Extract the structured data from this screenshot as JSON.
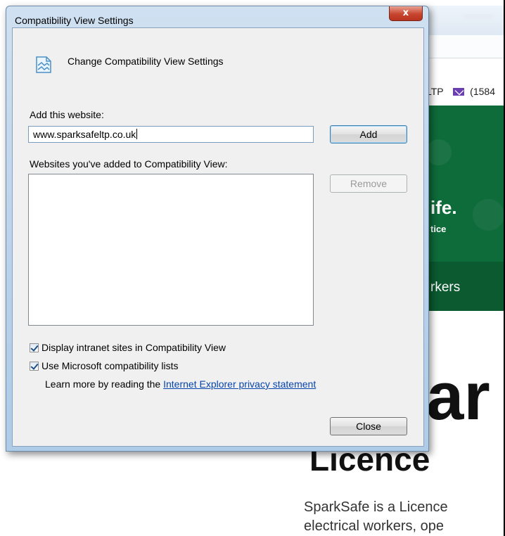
{
  "background_page": {
    "contact_text": "LTP",
    "phone_text": "(1584",
    "logo_text": "ife.",
    "logo_sub": "tice",
    "nav_item": "rkers",
    "big_word": "ar",
    "heading": "Licence",
    "paragraph_line1": "SparkSafe is a Licence",
    "paragraph_line2": "electrical workers, ope",
    "hero_color": "#0e6b3a"
  },
  "dialog": {
    "title": "Compatibility View Settings",
    "close_glyph": "x",
    "header": "Change Compatibility View Settings",
    "add_label": "Add this website:",
    "add_value": "www.sparksafeltp.co.uk",
    "add_button": "Add",
    "list_label": "Websites you've added to Compatibility View:",
    "list_items": [],
    "remove_button": "Remove",
    "check_intranet": "Display intranet sites in Compatibility View",
    "check_intranet_checked": true,
    "check_lists": "Use Microsoft compatibility lists",
    "check_lists_checked": true,
    "learn_more_prefix": "Learn more by reading the",
    "privacy_link": "Internet Explorer privacy statement",
    "close_button": "Close"
  }
}
